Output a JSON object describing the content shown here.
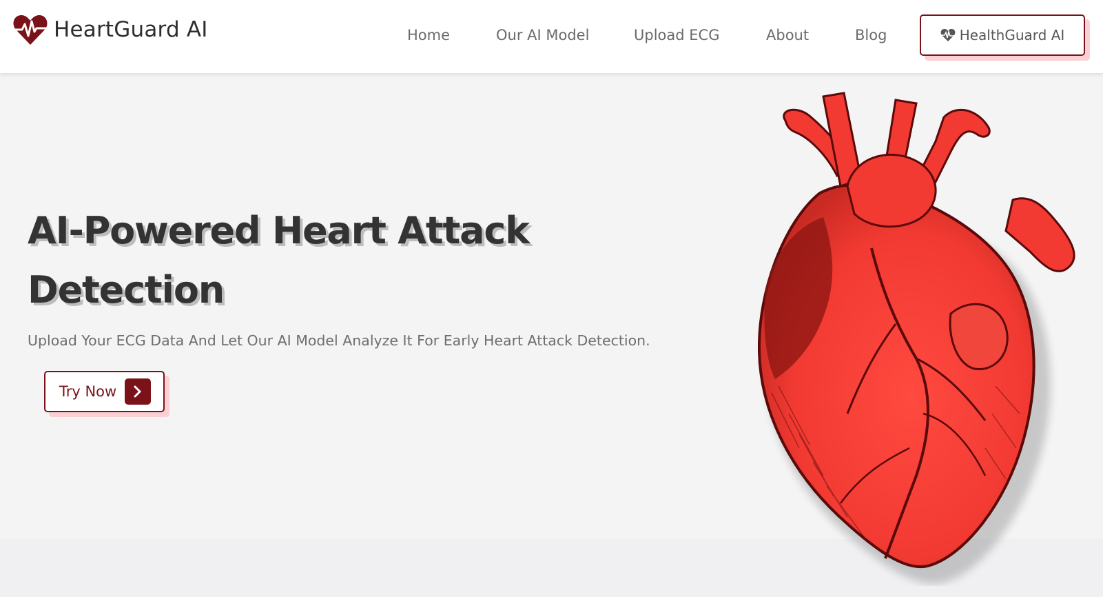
{
  "brand": {
    "name": "HeartGuard AI",
    "logo_icon": "heart-pulse-icon",
    "accent_color": "#7a1219"
  },
  "nav": {
    "items": [
      {
        "label": "Home"
      },
      {
        "label": "Our AI Model"
      },
      {
        "label": "Upload ECG"
      },
      {
        "label": "About"
      },
      {
        "label": "Blog"
      }
    ],
    "cta_label": "HealthGuard AI",
    "cta_icon": "heart-pulse-icon"
  },
  "hero": {
    "title": "AI-Powered Heart Attack Detection",
    "subtitle": "Upload Your ECG Data And Let Our AI Model Analyze It For Early Heart Attack Detection.",
    "button_label": "Try Now",
    "button_icon": "chevron-right-icon",
    "illustration": "anatomical-heart-illustration",
    "illustration_color": "#f23a32"
  }
}
